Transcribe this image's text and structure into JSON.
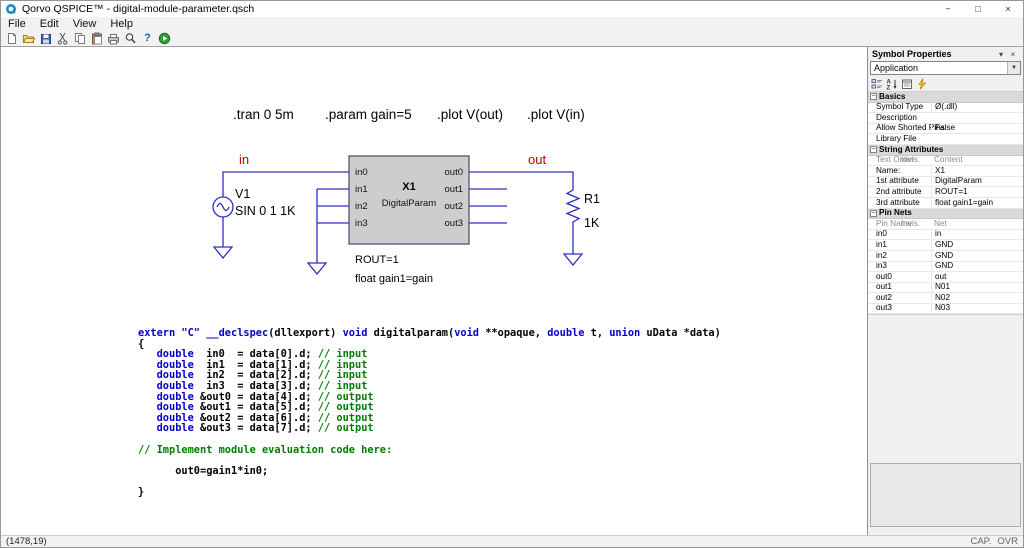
{
  "window": {
    "title": "Qorvo QSPICE™ - digital-module-parameter.qsch",
    "controls": {
      "minimize": "−",
      "maximize": "□",
      "close": "×"
    }
  },
  "menu": {
    "items": [
      "File",
      "Edit",
      "View",
      "Help"
    ]
  },
  "toolbar": {
    "icons": [
      "new-file",
      "open-folder",
      "save",
      "cut",
      "copy",
      "paste",
      "print",
      "zoom",
      "help",
      "run"
    ]
  },
  "schematic": {
    "directives": [
      ".tran 0 5m",
      ".param gain=5",
      ".plot V(out)",
      ".plot V(in)"
    ],
    "nets": {
      "in": "in",
      "out": "out"
    },
    "v1": {
      "ref": "V1",
      "value": "SIN 0 1 1K"
    },
    "x1": {
      "ref": "X1",
      "name": "DigitalParam",
      "pins_in": [
        "in0",
        "in1",
        "in2",
        "in3"
      ],
      "pins_out": [
        "out0",
        "out1",
        "out2",
        "out3"
      ],
      "attr2": "ROUT=1",
      "attr3": "float gain1=gain"
    },
    "r1": {
      "ref": "R1",
      "value": "1K"
    },
    "colors": {
      "wire": "#2e2ec4",
      "net_label": "#c00000",
      "symbol_fill": "#cdcdcd"
    }
  },
  "code": {
    "colors": {
      "keyword": "#0000c8",
      "comment": "#007c00",
      "plain": "#000000"
    },
    "lines": [
      [
        {
          "s": "kw",
          "t": "extern \"C\" __declspec"
        },
        {
          "s": "pl",
          "t": "(dllexport) "
        },
        {
          "s": "kw",
          "t": "void"
        },
        {
          "s": "pl",
          "t": " digitalparam("
        },
        {
          "s": "kw",
          "t": "void"
        },
        {
          "s": "pl",
          "t": " **opaque, "
        },
        {
          "s": "kw",
          "t": "double"
        },
        {
          "s": "pl",
          "t": " t, "
        },
        {
          "s": "kw",
          "t": "union"
        },
        {
          "s": "pl",
          "t": " uData *data)"
        }
      ],
      [
        {
          "s": "pl",
          "t": "{"
        }
      ],
      [
        {
          "s": "pl",
          "t": "   "
        },
        {
          "s": "kw",
          "t": "double"
        },
        {
          "s": "pl",
          "t": "  in0  = data[0].d; "
        },
        {
          "s": "cm",
          "t": "// input"
        }
      ],
      [
        {
          "s": "pl",
          "t": "   "
        },
        {
          "s": "kw",
          "t": "double"
        },
        {
          "s": "pl",
          "t": "  in1  = data[1].d; "
        },
        {
          "s": "cm",
          "t": "// input"
        }
      ],
      [
        {
          "s": "pl",
          "t": "   "
        },
        {
          "s": "kw",
          "t": "double"
        },
        {
          "s": "pl",
          "t": "  in2  = data[2].d; "
        },
        {
          "s": "cm",
          "t": "// input"
        }
      ],
      [
        {
          "s": "pl",
          "t": "   "
        },
        {
          "s": "kw",
          "t": "double"
        },
        {
          "s": "pl",
          "t": "  in3  = data[3].d; "
        },
        {
          "s": "cm",
          "t": "// input"
        }
      ],
      [
        {
          "s": "pl",
          "t": "   "
        },
        {
          "s": "kw",
          "t": "double"
        },
        {
          "s": "pl",
          "t": " &out0 = data[4].d; "
        },
        {
          "s": "cm",
          "t": "// output"
        }
      ],
      [
        {
          "s": "pl",
          "t": "   "
        },
        {
          "s": "kw",
          "t": "double"
        },
        {
          "s": "pl",
          "t": " &out1 = data[5].d; "
        },
        {
          "s": "cm",
          "t": "// output"
        }
      ],
      [
        {
          "s": "pl",
          "t": "   "
        },
        {
          "s": "kw",
          "t": "double"
        },
        {
          "s": "pl",
          "t": " &out2 = data[6].d; "
        },
        {
          "s": "cm",
          "t": "// output"
        }
      ],
      [
        {
          "s": "pl",
          "t": "   "
        },
        {
          "s": "kw",
          "t": "double"
        },
        {
          "s": "pl",
          "t": " &out3 = data[7].d; "
        },
        {
          "s": "cm",
          "t": "// output"
        }
      ],
      [],
      [
        {
          "s": "cm",
          "t": "// Implement module evaluation code here:"
        }
      ],
      [],
      [
        {
          "s": "pl",
          "t": "      out0=gain1*in0;"
        }
      ],
      [],
      [
        {
          "s": "pl",
          "t": "}"
        }
      ]
    ]
  },
  "properties": {
    "panel_title": "Symbol Properties",
    "selector": "Application",
    "rows": [
      {
        "type": "section",
        "label": "Basics"
      },
      {
        "type": "prop",
        "name": "Symbol Type",
        "value": "Ø(.dll)"
      },
      {
        "type": "prop",
        "name": "Description",
        "value": ""
      },
      {
        "type": "prop",
        "name": "Allow Shorted Pins",
        "value": "False"
      },
      {
        "type": "prop",
        "name": "Library File",
        "value": ""
      },
      {
        "type": "section",
        "label": "String Attributes"
      },
      {
        "type": "subheader",
        "cols": [
          "Text Order",
          "Invis.",
          "Content"
        ]
      },
      {
        "type": "prop",
        "name": "Name:",
        "value": "X1"
      },
      {
        "type": "prop",
        "name": "1st attribute",
        "value": "DigitalParam"
      },
      {
        "type": "prop",
        "name": "2nd attribute",
        "value": "ROUT=1"
      },
      {
        "type": "prop",
        "name": "3rd attribute",
        "value": "float gain1=gain"
      },
      {
        "type": "section",
        "label": "Pin Nets"
      },
      {
        "type": "subheader",
        "cols": [
          "Pin Name",
          "Invis.",
          "Net"
        ]
      },
      {
        "type": "prop",
        "name": "in0",
        "value": "in"
      },
      {
        "type": "prop",
        "name": "in1",
        "value": "GND"
      },
      {
        "type": "prop",
        "name": "in2",
        "value": "GND"
      },
      {
        "type": "prop",
        "name": "in3",
        "value": "GND"
      },
      {
        "type": "prop",
        "name": "out0",
        "value": "out"
      },
      {
        "type": "prop",
        "name": "out1",
        "value": "N01"
      },
      {
        "type": "prop",
        "name": "out2",
        "value": "N02"
      },
      {
        "type": "prop",
        "name": "out3",
        "value": "N03"
      }
    ]
  },
  "status": {
    "coords": "(1478,19)",
    "cap_indicator": "CAP.",
    "ovr_indicator": "OVR"
  }
}
